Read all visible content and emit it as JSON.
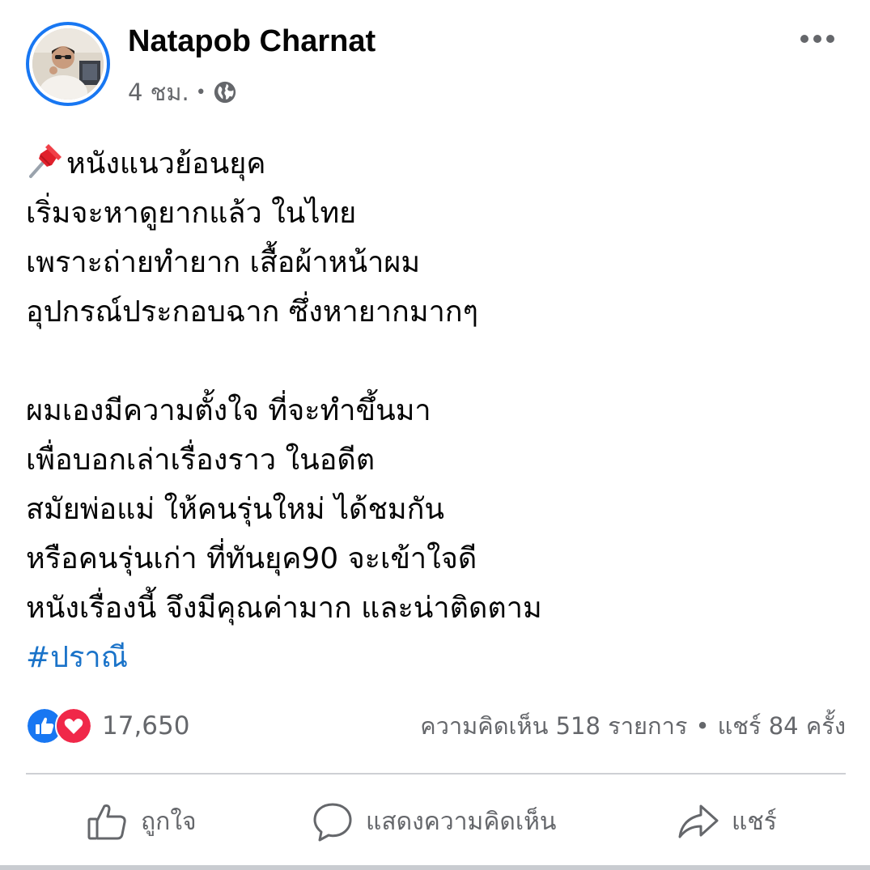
{
  "post": {
    "author": "Natapob Charnat",
    "time": "4 ชม.",
    "meta_separator": "•",
    "privacy_icon": "globe-icon",
    "pin_icon": "pushpin-emoji",
    "lines": [
      "หนังแนวย้อนยุค",
      "เริ่มจะหาดูยากแล้ว ในไทย",
      "เพราะถ่ายทำยาก เสื้อผ้าหน้าผม",
      "อุปกรณ์ประกอบฉาก ซึ่งหายากมากๆ",
      "",
      "ผมเองมีความตั้งใจ ที่จะทำขึ้นมา",
      "เพื่อบอกเล่าเรื่องราว ในอดีต",
      "สมัยพ่อแม่ ให้คนรุ่นใหม่ ได้ชมกัน",
      "หรือคนรุ่นเก่า ที่ทันยุค90 จะเข้าใจดี",
      "หนังเรื่องนี้ จึงมีคุณค่ามาก และน่าติดตาม"
    ],
    "hashtag": "#ปราณี"
  },
  "reactions": {
    "icons": [
      "like-icon",
      "love-icon"
    ],
    "count": "17,650",
    "comments": "ความคิดเห็น 518 รายการ",
    "separator": "•",
    "shares": "แชร์ 84 ครั้ง"
  },
  "actions": {
    "like": "ถูกใจ",
    "comment": "แสดงความคิดเห็น",
    "share": "แชร์"
  },
  "colors": {
    "accent": "#1877f2",
    "secondary_text": "#65676b",
    "hashtag": "#1a73c9",
    "love": "#f02849"
  }
}
